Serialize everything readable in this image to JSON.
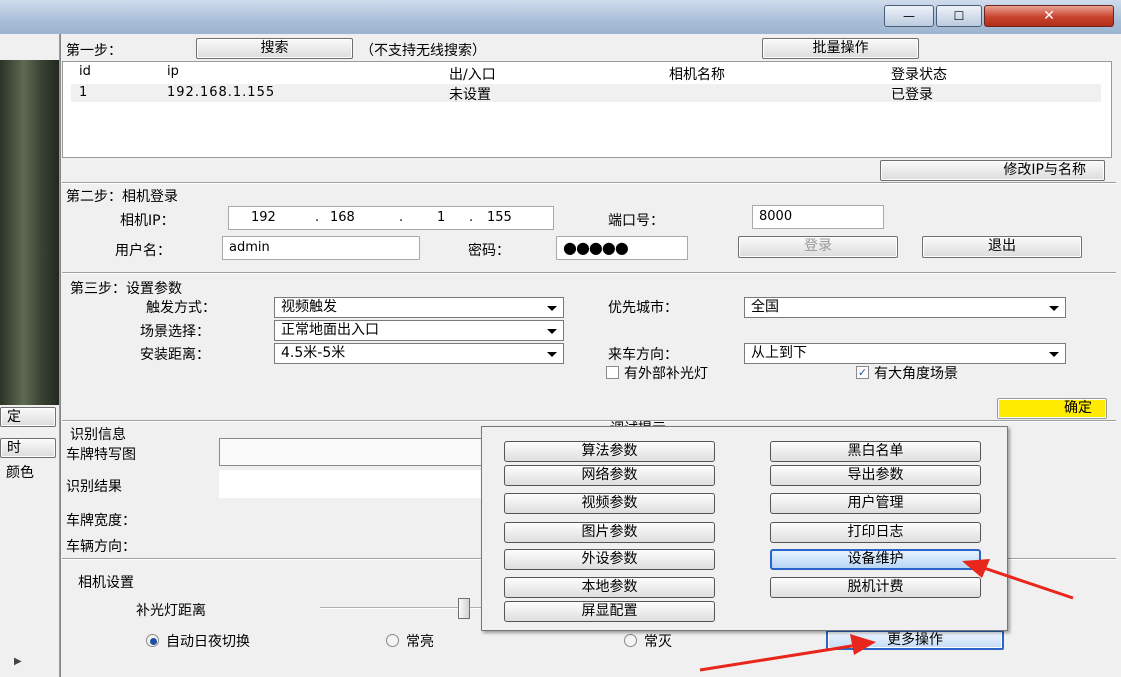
{
  "window": {
    "min": "—",
    "max": "☐",
    "close": "✕"
  },
  "step1": {
    "label": "第一步：",
    "search_button": "搜索",
    "note": "（不支持无线搜索）",
    "batch_button": "批量操作",
    "columns": [
      "id",
      "ip",
      "出/入口",
      "相机名称",
      "登录状态"
    ],
    "rows": [
      {
        "id": "1",
        "ip": "192.168.1.155",
        "gate": "未设置",
        "name": "",
        "status": "已登录"
      }
    ],
    "modify_button": "修改IP与名称"
  },
  "step2": {
    "title": "第二步：相机登录",
    "ip_label": "相机IP：",
    "ip": [
      "192",
      "168",
      "1",
      "155"
    ],
    "port_label": "端口号：",
    "port": "8000",
    "user_label": "用户名：",
    "user": "admin",
    "pwd_label": "密码：",
    "pwd": "●●●●●",
    "login_button": "登录",
    "logout_button": "退出"
  },
  "step3": {
    "title": "第三步：设置参数",
    "trigger_label": "触发方式：",
    "trigger": "视频触发",
    "city_label": "优先城市：",
    "city": "全国",
    "scene_label": "场景选择：",
    "scene": "正常地面出入口",
    "distance_label": "安装距离：",
    "distance": "4.5米-5米",
    "direction_label": "来车方向：",
    "direction": "从上到下",
    "ext_light": "有外部补光灯",
    "wide_angle": "有大角度场景",
    "confirm_button": "确定"
  },
  "recog": {
    "title": "识别信息",
    "debug_title": "调试提示",
    "plate_img_label": "车牌特写图",
    "result_label": "识别结果",
    "width_label": "车牌宽度：",
    "direction_label": "车辆方向："
  },
  "camera": {
    "title": "相机设置",
    "light_label": "补光灯距离",
    "radio_auto": "自动日夜切换",
    "radio_on": "常亮",
    "radio_off": "常灭",
    "more_button": "更多操作"
  },
  "menu": {
    "left": [
      "算法参数",
      "网络参数",
      "视频参数",
      "图片参数",
      "外设参数",
      "本地参数",
      "屏显配置"
    ],
    "right": [
      "黑白名单",
      "导出参数",
      "用户管理",
      "打印日志",
      "设备维护",
      "脱机计费"
    ]
  },
  "left_fragments": [
    "定",
    "时",
    "颜色"
  ],
  "colors": {
    "highlight": "#2a64c8",
    "confirm_bg": "#ffeb00",
    "arrow": "#e8261b"
  }
}
